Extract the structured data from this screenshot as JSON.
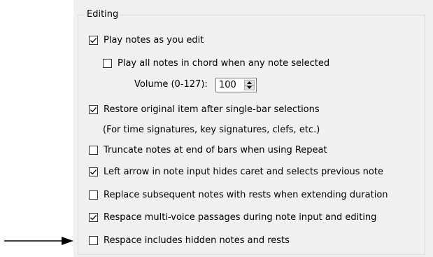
{
  "group": {
    "title": "Editing"
  },
  "options": [
    {
      "id": "play-notes",
      "label": "Play notes as you edit",
      "checked": true
    },
    {
      "id": "play-all-notes-chord",
      "label": "Play all notes in chord when any note selected",
      "checked": false
    },
    {
      "id": "restore-original",
      "label": "Restore original item after single-bar selections",
      "checked": true
    },
    {
      "id": "truncate-notes",
      "label": "Truncate notes at end of bars when using Repeat",
      "checked": false
    },
    {
      "id": "left-arrow-hides-caret",
      "label": "Left arrow in note input hides caret and selects previous note",
      "checked": true
    },
    {
      "id": "replace-subsequent",
      "label": "Replace subsequent notes with rests when extending duration",
      "checked": false
    },
    {
      "id": "respace-multivoice",
      "label": "Respace multi-voice passages during note input and editing",
      "checked": true
    },
    {
      "id": "respace-hidden",
      "label": "Respace includes hidden notes and rests",
      "checked": false
    }
  ],
  "volume": {
    "label": "Volume (0-127):",
    "value": "100"
  },
  "restore_note": "(For time signatures, key signatures, clefs, etc.)",
  "icons": {
    "check": "checkmark-icon",
    "spin_up": "chevron-up-icon",
    "spin_down": "chevron-down-icon",
    "callout": "right-arrow-icon"
  }
}
